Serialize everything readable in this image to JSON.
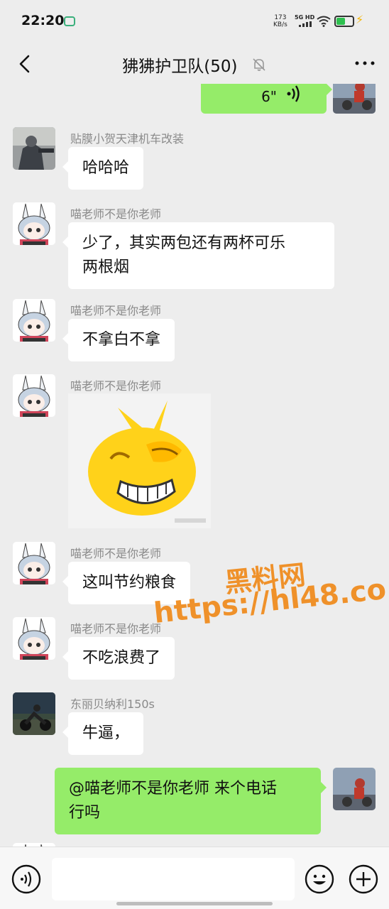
{
  "status_bar": {
    "time": "22:20",
    "net_speed_value": "173",
    "net_speed_unit": "KB/s",
    "network": "5G HD",
    "battery_percent": 55
  },
  "header": {
    "title": "狒狒护卫队(50)",
    "back_icon": "chevron-left-icon",
    "mute_icon": "bell-off-icon",
    "more_icon": "more-dots-icon"
  },
  "messages": [
    {
      "side": "right",
      "type": "voice",
      "text": "6\""
    },
    {
      "side": "left",
      "sender": "贴膜小贺天津机车改装",
      "type": "text",
      "text": "哈哈哈"
    },
    {
      "side": "left",
      "sender": "喵老师不是你老师",
      "type": "text",
      "lines": [
        "少了，其实两包还有两杯可乐",
        "两根烟"
      ]
    },
    {
      "side": "left",
      "sender": "喵老师不是你老师",
      "type": "text",
      "text": "不拿白不拿"
    },
    {
      "side": "left",
      "sender": "喵老师不是你老师",
      "type": "sticker",
      "sticker": "laughing-emoji-sticker"
    },
    {
      "side": "left",
      "sender": "喵老师不是你老师",
      "type": "text",
      "text": "这叫节约粮食"
    },
    {
      "side": "left",
      "sender": "喵老师不是你老师",
      "type": "text",
      "text": "不吃浪费了"
    },
    {
      "side": "left",
      "sender": "东丽贝纳利150s",
      "type": "text",
      "text": "牛逼，"
    },
    {
      "side": "right",
      "type": "text",
      "lines": [
        "@喵老师不是你老师  来个电话",
        "行吗"
      ]
    }
  ],
  "watermark": {
    "line1": "黑料网",
    "line2": "https://hl48.co",
    "color": "#f08a1a"
  },
  "input_bar": {
    "voice_icon": "voice-input-icon",
    "placeholder": "",
    "emoji_icon": "emoji-icon",
    "plus_icon": "plus-circle-icon"
  },
  "colors": {
    "background": "#ededed",
    "bubble_self": "#95ec69",
    "bubble_other": "#ffffff"
  }
}
